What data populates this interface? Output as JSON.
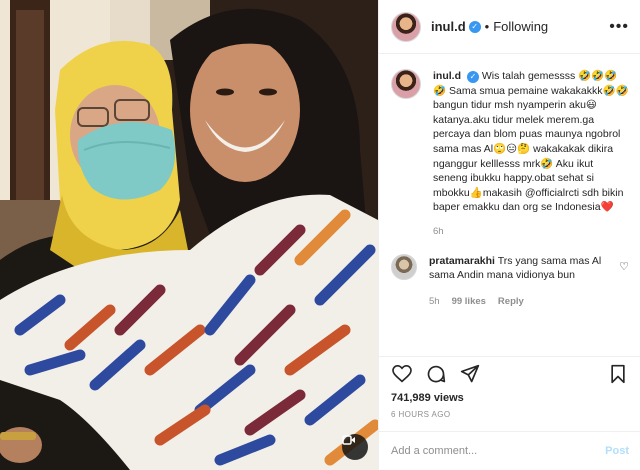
{
  "header": {
    "username": "inul.d",
    "separator": "•",
    "follow_status": "Following",
    "more_label": "•••"
  },
  "caption": {
    "username": "inul.d",
    "text": "Wis talah gemessss 🤣🤣🤣🤣 Sama smua pemaine wakakakkk🤣🤣 bangun tidur msh nyamperin aku😃 katanya.aku tidur melek merem.ga percaya dan blom puas maunya ngobrol sama mas Al🙄😑🤔 wakakakak dikira nganggur kelllesss mrk🤣 Aku ikut seneng ibukku happy.obat sehat si mbokku👍makasih @officialrcti sdh bikin baper emakku dan org se Indonesia❤️",
    "time": "6h"
  },
  "comment": {
    "username": "pratamarakhi",
    "text": "Trs yang sama mas Al sama Andin mana vidionya bun",
    "time": "5h",
    "likes": "99 likes",
    "reply_label": "Reply"
  },
  "stats": {
    "views": "741,989 views",
    "posted": "6 HOURS AGO"
  },
  "add_comment": {
    "placeholder": "Add a comment...",
    "post_label": "Post"
  },
  "colors": {
    "verified": "#3897f0",
    "muted": "#8e8e8e",
    "post_disabled": "#b2dffc",
    "love": "#ed4956"
  },
  "icons": [
    "video-camera-icon",
    "verified-icon",
    "more-icon",
    "heart-icon",
    "comment-icon",
    "share-icon",
    "bookmark-icon"
  ]
}
